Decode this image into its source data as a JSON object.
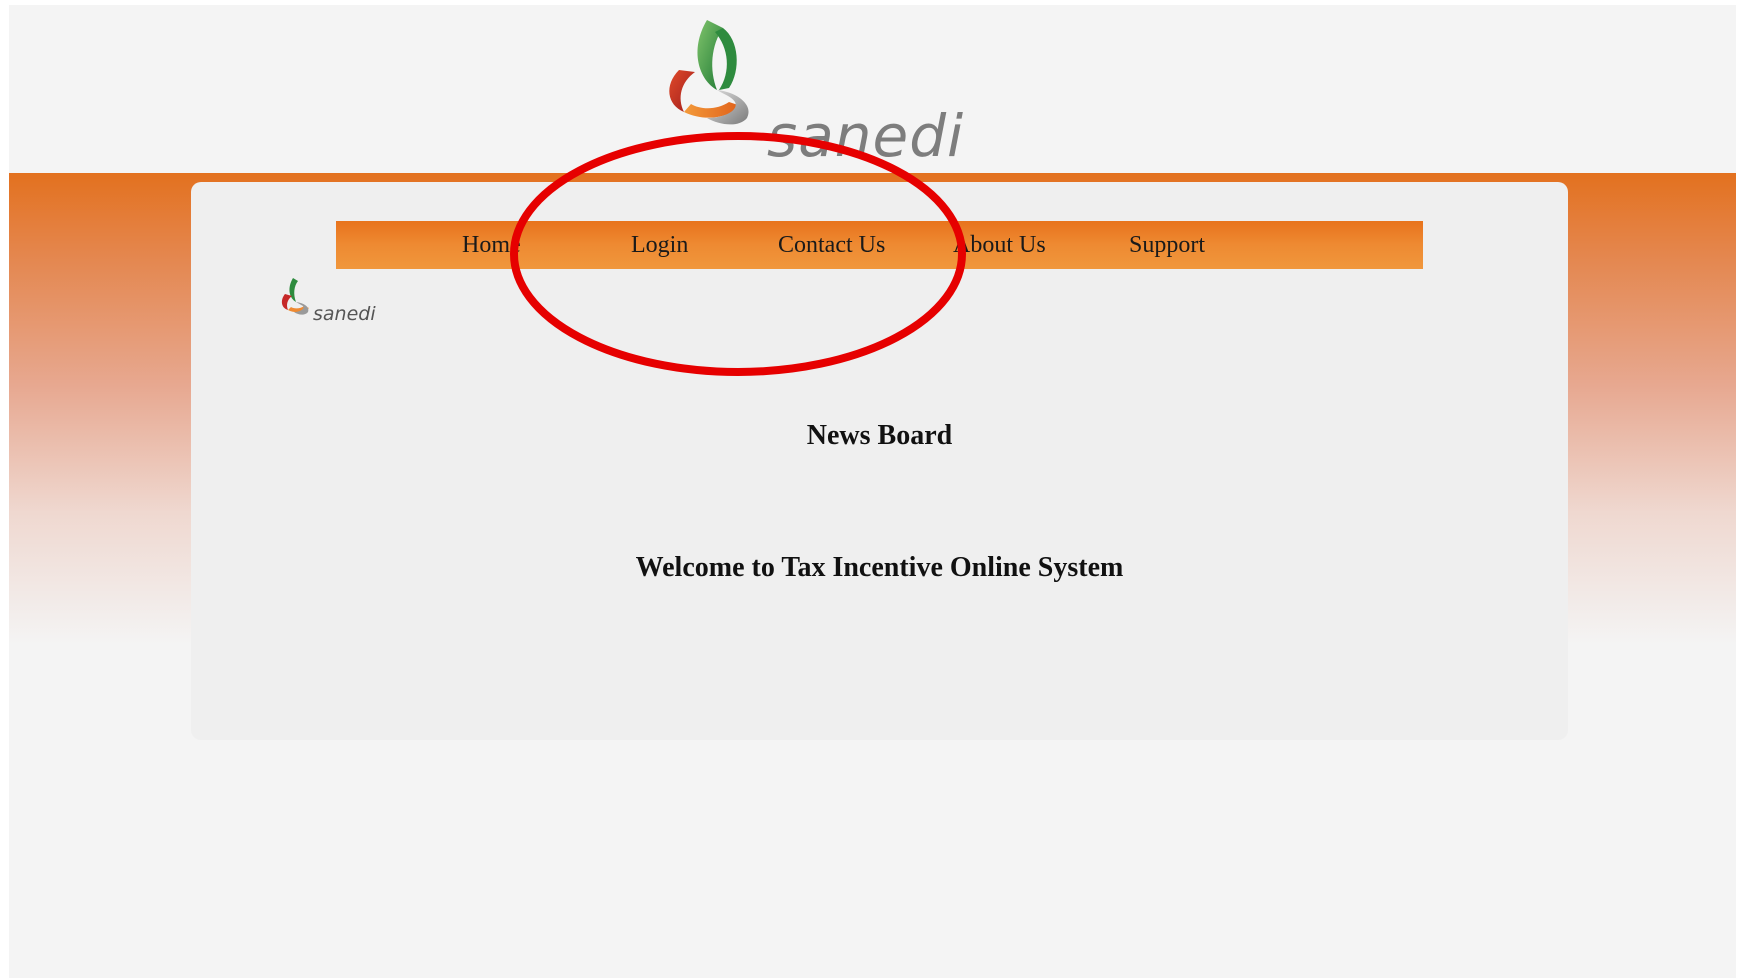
{
  "brand": {
    "logo_text": "sanedi",
    "colors": {
      "orange": "#e8731c",
      "green": "#2e8b3e",
      "red": "#c62828",
      "grey": "#7a7a7a"
    }
  },
  "nav": {
    "items": [
      {
        "label": "Home"
      },
      {
        "label": "Login"
      },
      {
        "label": "Contact Us"
      },
      {
        "label": "About Us"
      },
      {
        "label": "Support"
      }
    ]
  },
  "main": {
    "news_title": "News Board",
    "welcome": "Welcome to Tax Incentive Online System"
  },
  "annotation": {
    "shape": "ellipse",
    "color": "#e60000"
  }
}
